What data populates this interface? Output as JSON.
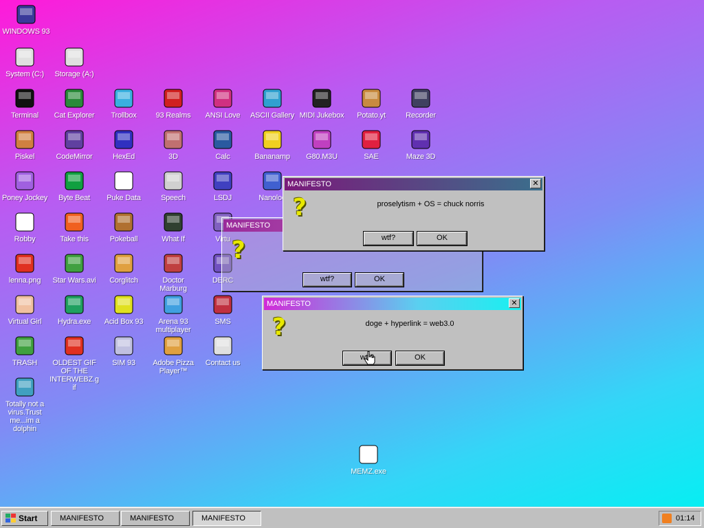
{
  "desktop": {
    "icons": [
      {
        "label": "WINDOWS 93",
        "icon": "computer-icon"
      },
      {
        "label": "System (C:)",
        "icon": "hard-drive-icon"
      },
      {
        "label": "Storage (A:)",
        "icon": "floppy-drive-icon"
      },
      {
        "label": "Terminal",
        "icon": "terminal-icon"
      },
      {
        "label": "Cat Explorer",
        "icon": "cat-explorer-icon"
      },
      {
        "label": "Trollbox",
        "icon": "chat-bubble-icon"
      },
      {
        "label": "93 Realms",
        "icon": "realms-icon"
      },
      {
        "label": "ANSI Love",
        "icon": "ansi-love-icon"
      },
      {
        "label": "ASCII Gallery",
        "icon": "ascii-gallery-icon"
      },
      {
        "label": "MIDI Jukebox",
        "icon": "piano-icon"
      },
      {
        "label": "Potato.yt",
        "icon": "potato-icon"
      },
      {
        "label": "Recorder",
        "icon": "microphone-icon"
      },
      {
        "label": "Piskel",
        "icon": "palette-icon"
      },
      {
        "label": "CodeMirror",
        "icon": "codemirror-icon"
      },
      {
        "label": "HexEd",
        "icon": "cube-icon"
      },
      {
        "label": "3D",
        "icon": "teapot-icon"
      },
      {
        "label": "Calc",
        "icon": "calculator-icon"
      },
      {
        "label": "Bananamp",
        "icon": "banana-icon"
      },
      {
        "label": "G80.M3U",
        "icon": "audio-file-icon"
      },
      {
        "label": "SAE",
        "icon": "ball-icon"
      },
      {
        "label": "Maze 3D",
        "icon": "maze-icon"
      },
      {
        "label": "Poney Jockey",
        "icon": "pony-icon"
      },
      {
        "label": "Byte Beat",
        "icon": "bytebeat-icon"
      },
      {
        "label": "Puke Data",
        "icon": "pd-icon"
      },
      {
        "label": "Speech",
        "icon": "speech-face-icon"
      },
      {
        "label": "LSDJ",
        "icon": "lsdj-icon"
      },
      {
        "label": "Nanoloo",
        "icon": "nanoloop-icon"
      },
      {
        "label": "Robby",
        "icon": "stick-figure-icon"
      },
      {
        "label": "Take this",
        "icon": "baby-icon"
      },
      {
        "label": "Pokeball",
        "icon": "cookie-icon"
      },
      {
        "label": "What If",
        "icon": "whatif-icon"
      },
      {
        "label": "Virtu",
        "icon": "virtual-icon"
      },
      {
        "label": "lenna.png",
        "icon": "image-file-icon"
      },
      {
        "label": "Star Wars.avi",
        "icon": "yoda-icon"
      },
      {
        "label": "Corglitch",
        "icon": "corgi-icon"
      },
      {
        "label": "Doctor Marburg",
        "icon": "doctor-icon"
      },
      {
        "label": "DERC",
        "icon": "derc-icon"
      },
      {
        "label": "Virtual Girl",
        "icon": "girl-icon"
      },
      {
        "label": "Hydra.exe",
        "icon": "hydra-icon"
      },
      {
        "label": "Acid Box 93",
        "icon": "smiley-icon"
      },
      {
        "label": "Arena 93 multiplayer",
        "icon": "arena-cube-icon"
      },
      {
        "label": "SMS",
        "icon": "sms-icon"
      },
      {
        "label": "TRASH",
        "icon": "trash-icon"
      },
      {
        "label": "OLDEST GIF OF THE INTERWEBZ.gif",
        "icon": "gif-file-icon"
      },
      {
        "label": "SIM 93",
        "icon": "book-icon"
      },
      {
        "label": "Adobe Pizza Player™",
        "icon": "pizza-icon"
      },
      {
        "label": "Contact us",
        "icon": "contact-icon"
      },
      {
        "label": "Totally not a virus.Trust me...im a dolphin",
        "icon": "dolphin-icon"
      },
      {
        "label": "MEMZ.exe",
        "icon": "shortcut-file-icon"
      }
    ]
  },
  "dialogs": [
    {
      "title": "MANIFESTO",
      "message": "proselytism + OS = chuck norris",
      "btn1": "wtf?",
      "btn2": "OK"
    },
    {
      "title": "MANIFESTO",
      "message": "",
      "btn1": "wtf?",
      "btn2": "OK"
    },
    {
      "title": "MANIFESTO",
      "message": "doge + hyperlink = web3.0",
      "btn1": "wtf?",
      "btn2": "OK"
    }
  ],
  "taskbar": {
    "start_label": "Start",
    "tasks": [
      "MANIFESTO",
      "MANIFESTO",
      "MANIFESTO"
    ],
    "clock": "01:14"
  },
  "colors": {
    "bg_top_left": "#ff1ad9",
    "bg_bottom_right": "#00f2f2",
    "window_face": "#c0c0c0"
  }
}
